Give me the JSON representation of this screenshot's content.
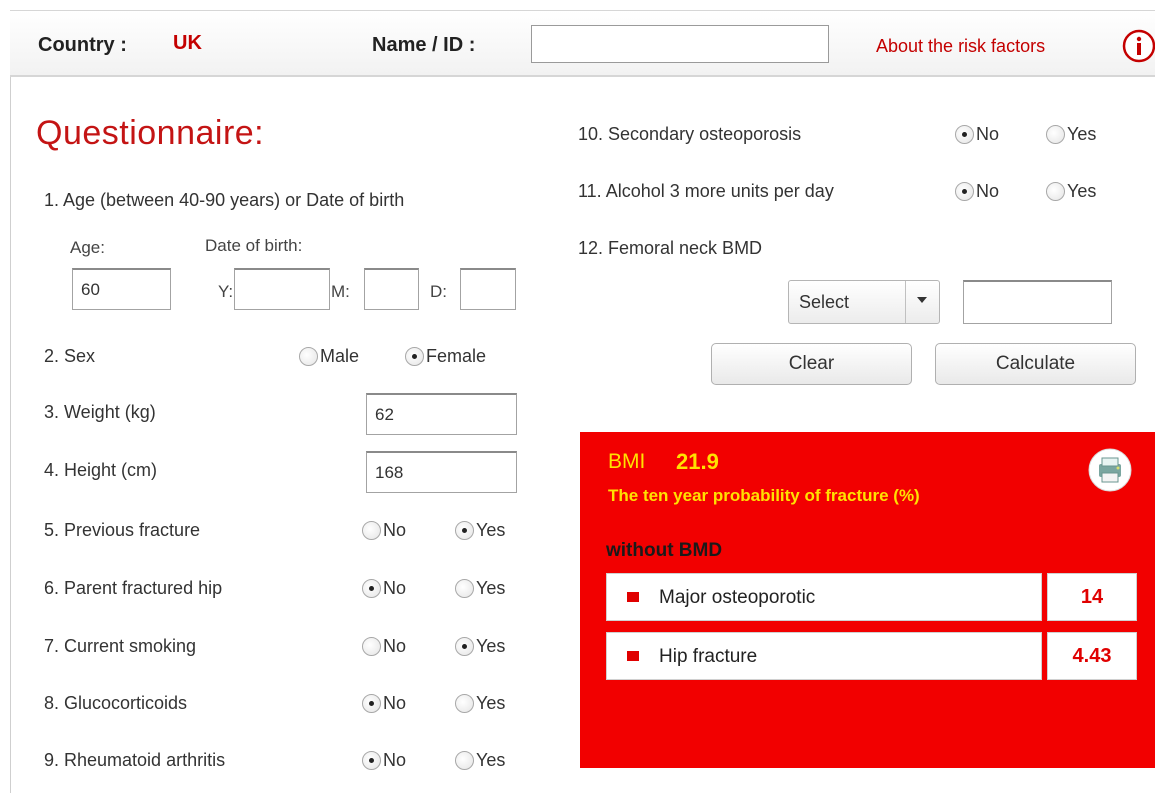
{
  "header": {
    "country_label": "Country :",
    "country_value": "UK",
    "name_label": "Name / ID :",
    "name_value": "",
    "about_link": "About the risk factors",
    "info_icon": "info-circle-icon"
  },
  "questionnaire": {
    "title": "Questionnaire:",
    "q1": {
      "label": "1. Age (between 40-90 years) or Date of birth",
      "age_label": "Age:",
      "age_value": "60",
      "dob_label": "Date of birth:",
      "y_label": "Y:",
      "m_label": "M:",
      "d_label": "D:",
      "y_value": "",
      "m_value": "",
      "d_value": ""
    },
    "q2": {
      "label": "2. Sex",
      "opt1": "Male",
      "opt2": "Female",
      "selected": "Female"
    },
    "q3": {
      "label": "3. Weight (kg)",
      "value": "62"
    },
    "q4": {
      "label": "4. Height (cm)",
      "value": "168"
    },
    "q5": {
      "label": "5. Previous fracture",
      "no": "No",
      "yes": "Yes",
      "selected": "Yes"
    },
    "q6": {
      "label": "6. Parent fractured hip",
      "no": "No",
      "yes": "Yes",
      "selected": "No"
    },
    "q7": {
      "label": "7. Current smoking",
      "no": "No",
      "yes": "Yes",
      "selected": "Yes"
    },
    "q8": {
      "label": "8. Glucocorticoids",
      "no": "No",
      "yes": "Yes",
      "selected": "No"
    },
    "q9": {
      "label": "9. Rheumatoid arthritis",
      "no": "No",
      "yes": "Yes",
      "selected": "No"
    },
    "q10": {
      "label": "10. Secondary osteoporosis",
      "no": "No",
      "yes": "Yes",
      "selected": "No"
    },
    "q11": {
      "label": "11. Alcohol 3 more units per day",
      "no": "No",
      "yes": "Yes",
      "selected": "No"
    },
    "q12": {
      "label": "12. Femoral neck BMD",
      "select_value": "Select",
      "bmd_value": ""
    }
  },
  "buttons": {
    "clear": "Clear",
    "calculate": "Calculate"
  },
  "result": {
    "bmi_label": "BMI",
    "bmi_value": "21.9",
    "probability_title": "The ten year probability of fracture (%)",
    "without_bmd": "without BMD",
    "rows": [
      {
        "name": "Major osteoporotic",
        "value": "14"
      },
      {
        "name": "Hip fracture",
        "value": "4.43"
      }
    ],
    "print_icon": "printer-icon",
    "colors": {
      "panel": "#f20000",
      "highlight": "#ffe100",
      "value": "#e00000"
    }
  }
}
